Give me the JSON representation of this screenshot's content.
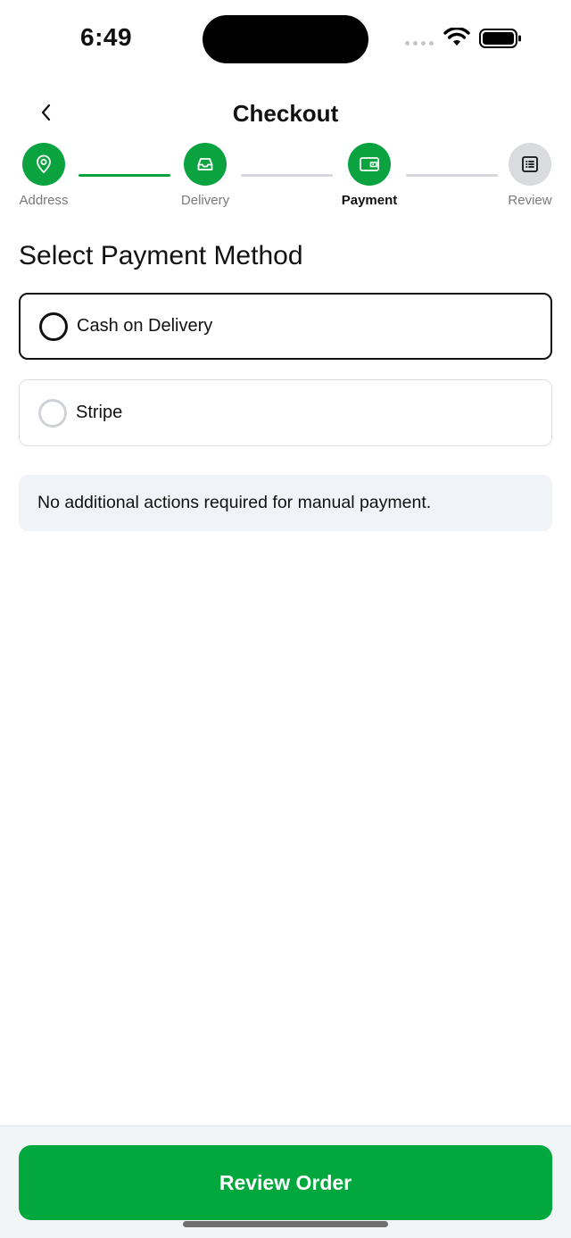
{
  "status_bar": {
    "time": "6:49"
  },
  "header": {
    "title": "Checkout",
    "back_icon": "chevron-left-icon"
  },
  "stepper": {
    "steps": [
      {
        "label": "Address",
        "icon": "map-pin-icon",
        "state": "done"
      },
      {
        "label": "Delivery",
        "icon": "inbox-icon",
        "state": "done"
      },
      {
        "label": "Payment",
        "icon": "wallet-icon",
        "state": "current"
      },
      {
        "label": "Review",
        "icon": "list-icon",
        "state": "todo"
      }
    ]
  },
  "payment": {
    "section_title": "Select Payment Method",
    "options": [
      {
        "label": "Cash on Delivery",
        "selected": true
      },
      {
        "label": "Stripe",
        "selected": false
      }
    ],
    "info_text": "No additional actions required for manual payment."
  },
  "footer": {
    "button_label": "Review Order"
  },
  "colors": {
    "accent": "#02a83e",
    "step_done": "#0aa340",
    "step_todo": "#d9dbde",
    "info_bg": "#f0f3f7"
  }
}
